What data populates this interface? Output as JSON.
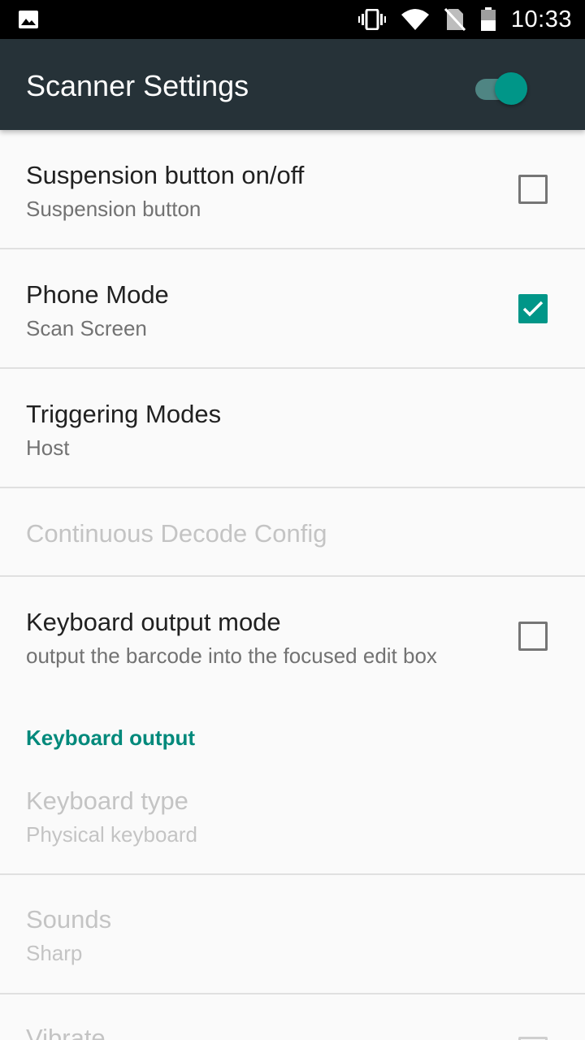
{
  "status_bar": {
    "time": "10:33",
    "icons": [
      "image-notification-icon",
      "vibrate-icon",
      "wifi-icon",
      "no-sim-icon",
      "battery-icon"
    ]
  },
  "app_bar": {
    "title": "Scanner Settings",
    "master_toggle_on": true,
    "accent_color": "#009688",
    "background_color": "#263238"
  },
  "preferences": [
    {
      "title": "Suspension button on/off",
      "summary": "Suspension button",
      "checkbox": "unchecked",
      "enabled": true
    },
    {
      "title": "Phone Mode",
      "summary": "Scan Screen",
      "checkbox": "checked",
      "enabled": true
    },
    {
      "title": "Triggering Modes",
      "summary": "Host",
      "enabled": true
    },
    {
      "title": "Continuous Decode Config",
      "enabled": false
    },
    {
      "title": "Keyboard output mode",
      "summary": "output the barcode into the focused edit box",
      "checkbox": "unchecked",
      "enabled": true
    }
  ],
  "category": {
    "label": "Keyboard output"
  },
  "keyboard_prefs": [
    {
      "title": "Keyboard type",
      "summary": "Physical keyboard",
      "enabled": false
    },
    {
      "title": "Sounds",
      "summary": "Sharp",
      "enabled": false
    },
    {
      "title": "Vibrate",
      "enabled": false
    }
  ]
}
